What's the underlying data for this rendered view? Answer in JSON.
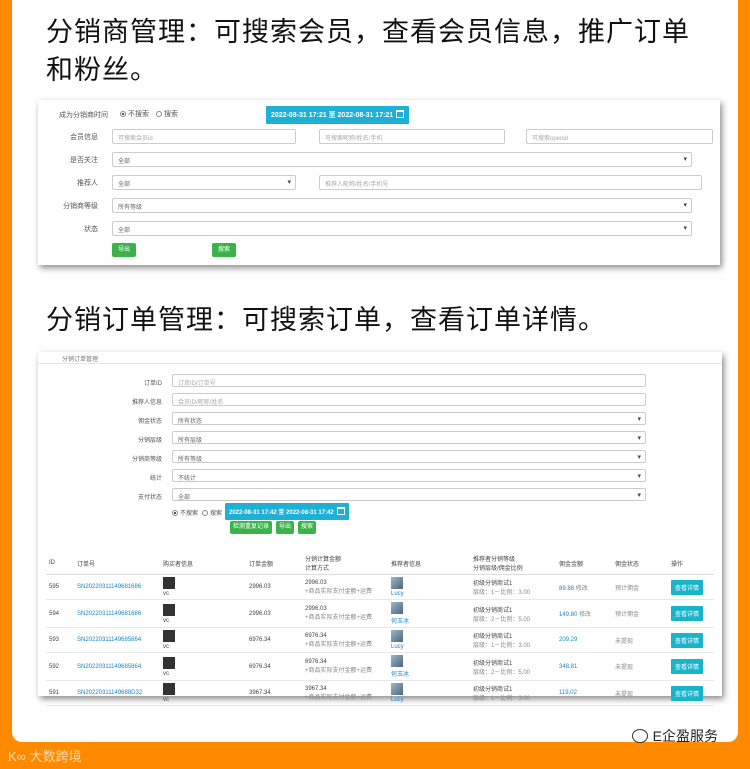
{
  "heading1": "分销商管理：可搜索会员，查看会员信息，推广订单和粉丝。",
  "heading2": "分销订单管理：可搜索订单，查看订单详情。",
  "distributor_panel": {
    "time_label": "成为分销商时间",
    "radio_no_search": "不搜索",
    "radio_search": "搜索",
    "date_range": "2022-08-31 17:21 至 2022-08-31 17:21",
    "member_label": "会员信息",
    "member_id_placeholder": "可搜索会员id",
    "member_name_placeholder": "可搜索昵称/姓名/手机",
    "openid_placeholder": "可搜索openid",
    "follow_label": "是否关注",
    "follow_value": "全部",
    "recommender_label": "推荐人",
    "recommender_value": "全部",
    "recommender_placeholder": "推荐人昵称/姓名/手机号",
    "level_label": "分销商等级",
    "level_value": "所有等级",
    "status_label": "状态",
    "status_value": "全部",
    "export_btn": "导出",
    "search_btn": "搜索"
  },
  "order_panel": {
    "title": "分销订单管理",
    "order_id_label": "订单ID",
    "order_id_placeholder": "订单ID/订单号",
    "recommender_label": "推荐人信息",
    "recommender_placeholder": "会员ID/昵称/姓名",
    "commission_status_label": "佣金状态",
    "commission_status_value": "所有状态",
    "level_label": "分销层级",
    "level_value": "所有层级",
    "dist_level_label": "分销商等级",
    "dist_level_value": "所有等级",
    "stats_label": "统计",
    "stats_value": "不统计",
    "pay_status_label": "支付状态",
    "pay_status_value": "全部",
    "radio_no_search": "不搜索",
    "radio_search": "搜索",
    "date_range": "2022-08-31 17:42 至 2022-08-31 17:42",
    "btn_check": "检测重复记录",
    "btn_export": "导出",
    "btn_search": "搜索",
    "columns": [
      "ID",
      "订单号",
      "购买者信息",
      "订单金额",
      "分销计算金额\n计算方式",
      "推荐者信息",
      "推荐者分销等级\n分销层级/佣金比例",
      "佣金金额",
      "佣金状态",
      "操作"
    ],
    "rows": [
      {
        "id": "595",
        "order_no": "SN20220311149681686",
        "buyer": "vc",
        "amount": "2996.03",
        "calc_amount": "2996.03",
        "calc_method": "+商品实际支付金额+运费",
        "recommender": "Lucy",
        "level": "初级分销商试1",
        "ratio": "层级：1－比例：3.00",
        "commission": "89.88",
        "commission_tag": "修改",
        "status": "预计佣金",
        "action": "查看详情"
      },
      {
        "id": "594",
        "order_no": "SN20220311149681686",
        "buyer": "vc",
        "amount": "2996.03",
        "calc_amount": "2996.03",
        "calc_method": "+商品实际支付金额+运费",
        "recommender": "何玉冰",
        "level": "初级分销商试1",
        "ratio": "层级：2－比例：5.00",
        "commission": "149.80",
        "commission_tag": "修改",
        "status": "预计佣金",
        "action": "查看详情"
      },
      {
        "id": "593",
        "order_no": "SN20220311149685864",
        "buyer": "vc",
        "amount": "6976.34",
        "calc_amount": "6976.34",
        "calc_method": "+商品实际支付金额+运费",
        "recommender": "Lucy",
        "level": "初级分销商试1",
        "ratio": "层级：1－比例：3.00",
        "commission": "209.29",
        "commission_tag": "",
        "status": "未提现",
        "action": "查看详情"
      },
      {
        "id": "592",
        "order_no": "SN20220311149685864",
        "buyer": "vc",
        "amount": "6976.34",
        "calc_amount": "6976.34",
        "calc_method": "+商品实际支付金额+运费",
        "recommender": "何玉冰",
        "level": "初级分销商试1",
        "ratio": "层级：2－比例：5.00",
        "commission": "348.81",
        "commission_tag": "",
        "status": "未提现",
        "action": "查看详情"
      },
      {
        "id": "591",
        "order_no": "SN20220311149688D32",
        "buyer": "vc",
        "amount": "3967.34",
        "calc_amount": "3967.34",
        "calc_method": "+商品实际支付金额+运费",
        "recommender": "Lucy",
        "level": "初级分销商试1",
        "ratio": "层级：1－比例：3.00",
        "commission": "119.02",
        "commission_tag": "",
        "status": "未提现",
        "action": "查看详情"
      }
    ]
  },
  "footer_logo": "大数跨境",
  "footer_brand": "E企盈服务"
}
